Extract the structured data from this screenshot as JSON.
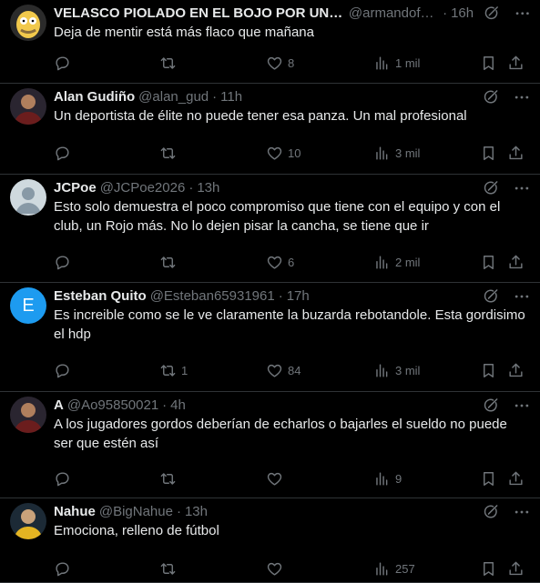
{
  "tweets": [
    {
      "name": "VELASCO PIOLADO EN EL BOJO POR UNO…",
      "handle": "@armandofa…",
      "time": "16h",
      "text": "Deja de mentir está más flaco que mañana",
      "replies": "",
      "retweets": "",
      "likes": "8",
      "views": "1 mil",
      "avatar": "cartoon"
    },
    {
      "name": "Alan Gudiño",
      "handle": "@alan_gud",
      "time": "11h",
      "text": "Un deportista de élite no puede tener esa panza. Un mal profesional",
      "replies": "",
      "retweets": "",
      "likes": "10",
      "views": "3 mil",
      "avatar": "photo"
    },
    {
      "name": "JCPoe",
      "handle": "@JCPoe2026",
      "time": "13h",
      "text": "Esto solo demuestra el poco compromiso que tiene con el equipo y con el club, un Rojo más. No lo dejen pisar la cancha, se tiene que ir",
      "replies": "",
      "retweets": "",
      "likes": "6",
      "views": "2 mil",
      "avatar": "default"
    },
    {
      "name": "Esteban Quito",
      "handle": "@Esteban65931961",
      "time": "17h",
      "text": "Es increible como se le ve claramente la buzarda rebotandole. Esta gordisimo el hdp",
      "replies": "",
      "retweets": "1",
      "likes": "84",
      "views": "3 mil",
      "avatar": "letter",
      "avatar_letter": "E",
      "avatar_color": "#1d9bf0"
    },
    {
      "name": "A",
      "handle": "@Ao95850021",
      "time": "4h",
      "text": "A los jugadores gordos deberían de echarlos o bajarles el sueldo no puede ser que estén así",
      "replies": "",
      "retweets": "",
      "likes": "",
      "views": "9",
      "avatar": "photo"
    },
    {
      "name": "Nahue",
      "handle": "@BigNahue",
      "time": "13h",
      "text": "Emociona, relleno de fútbol",
      "replies": "",
      "retweets": "",
      "likes": "",
      "views": "257",
      "avatar": "photo"
    }
  ],
  "separator": "·",
  "icons": {
    "reply": "reply-icon",
    "retweet": "retweet-icon",
    "like": "like-icon",
    "views": "views-icon",
    "bookmark": "bookmark-icon",
    "share": "share-icon",
    "grok": "grok-icon",
    "more": "more-icon"
  },
  "colors": {
    "background": "#000000",
    "text": "#e7e9ea",
    "muted": "#71767b",
    "divider": "#2f3336",
    "accent": "#1d9bf0"
  }
}
